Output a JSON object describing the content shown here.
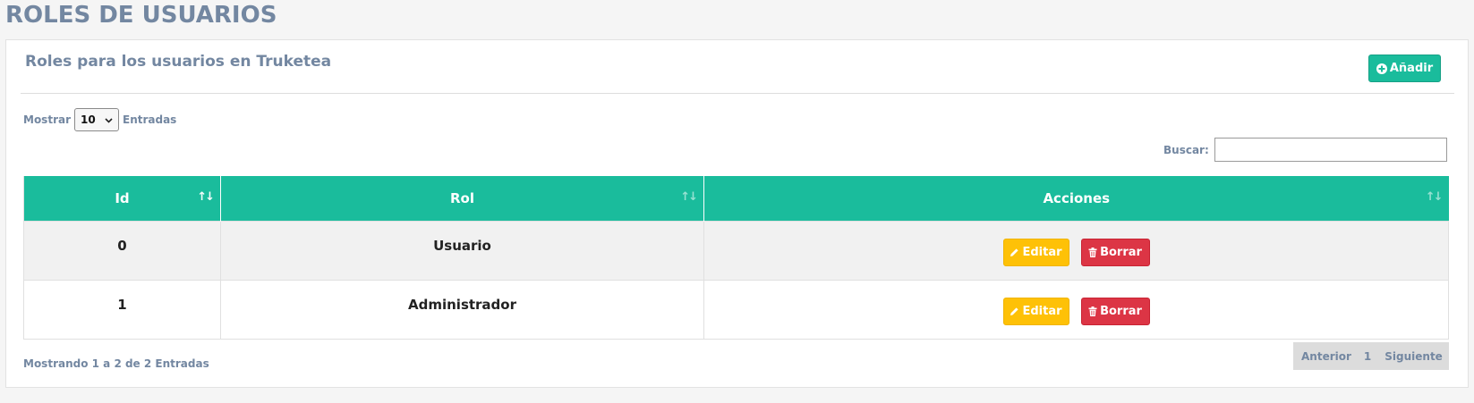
{
  "page": {
    "title": "ROLES DE USUARIOS"
  },
  "card": {
    "title": "Roles para los usuarios en Truketea",
    "add_button_label": "Añadir"
  },
  "length_control": {
    "prefix": "Mostrar",
    "selected_value": "10",
    "suffix": "Entradas"
  },
  "search": {
    "label": "Buscar:",
    "value": ""
  },
  "table": {
    "columns": [
      {
        "label": "Id"
      },
      {
        "label": "Rol"
      },
      {
        "label": "Acciones"
      }
    ],
    "rows": [
      {
        "id": "0",
        "rol": "Usuario",
        "edit_label": "Editar",
        "delete_label": "Borrar"
      },
      {
        "id": "1",
        "rol": "Administrador",
        "edit_label": "Editar",
        "delete_label": "Borrar"
      }
    ]
  },
  "info_text": "Mostrando 1 a 2 de 2 Entradas",
  "pagination": {
    "previous": "Anterior",
    "current_page": "1",
    "next": "Siguiente"
  },
  "icons": {
    "add": "plus-circle-icon",
    "edit": "pencil-icon",
    "delete": "trash-icon",
    "sort": "sort-icon",
    "dropdown": "chevron-down-icon"
  },
  "colors": {
    "accent": "#1abc9c",
    "title_text": "#7387a1",
    "edit_button": "#fec107",
    "delete_button": "#dc3545",
    "page_background": "#f5f5f5"
  }
}
